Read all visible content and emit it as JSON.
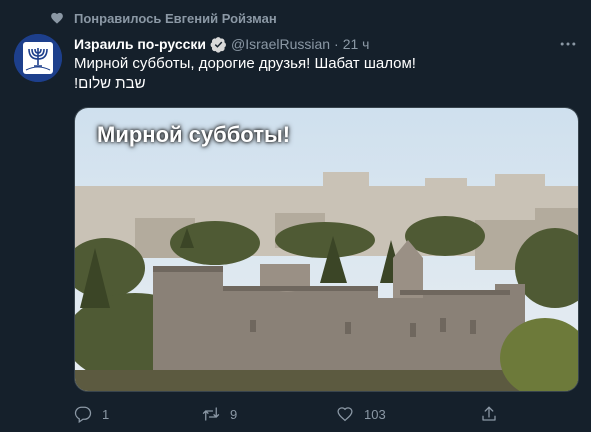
{
  "social_context": {
    "text": "Понравилось Евгений Ройзман",
    "icon": "heart-icon"
  },
  "tweet": {
    "author_name": "Израиль по-русски",
    "handle": "@IsraelRussian",
    "separator": "·",
    "time": "21 ч",
    "text_line1": "Мирной субботы, дорогие друзья! Шабат шалом!",
    "text_line2": "שבת שלום!",
    "media": {
      "overlay_text": "Мирной субботы!"
    },
    "actions": {
      "reply_count": "1",
      "retweet_count": "9",
      "like_count": "103"
    }
  },
  "colors": {
    "background": "#15202b",
    "secondary_text": "#8b98a5",
    "primary_text": "#ffffff",
    "verified": "#d9d9d9"
  }
}
